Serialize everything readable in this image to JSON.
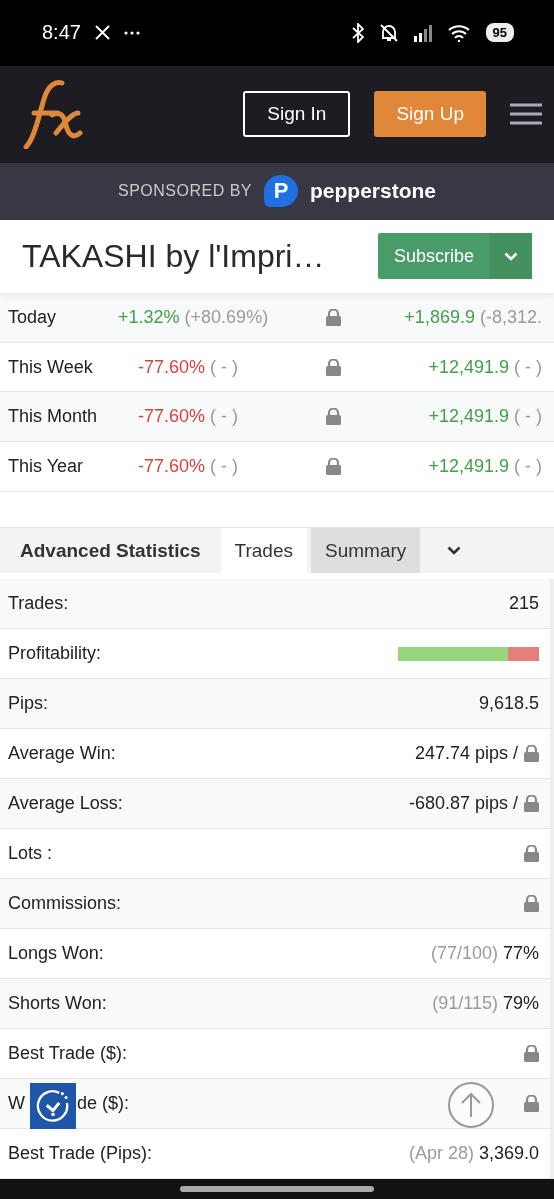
{
  "status_bar": {
    "time": "8:47",
    "battery": "95"
  },
  "header": {
    "buttons": [
      {
        "label": "Sign In",
        "kind": "outline"
      },
      {
        "label": "Sign Up",
        "kind": "filled"
      }
    ]
  },
  "sponsor": {
    "label": "SPONSORED BY",
    "brand": "pepperstone",
    "brand_mark": "P"
  },
  "title": {
    "text": "TAKASHI by l'Impri…",
    "button": "Subscribe"
  },
  "periods": [
    {
      "label": "Today",
      "gain": "+1.32%",
      "gain_positive": true,
      "gain_extra": "(+80.69%)",
      "pips": "+1,869.9",
      "pips_extra": "(-8,312."
    },
    {
      "label": "This Week",
      "gain": "-77.60%",
      "gain_positive": false,
      "gain_extra": "( - )",
      "pips": "+12,491.9",
      "pips_extra": "( - )"
    },
    {
      "label": "This Month",
      "gain": "-77.60%",
      "gain_positive": false,
      "gain_extra": "( - )",
      "pips": "+12,491.9",
      "pips_extra": "( - )"
    },
    {
      "label": "This Year",
      "gain": "-77.60%",
      "gain_positive": false,
      "gain_extra": "( - )",
      "pips": "+12,491.9",
      "pips_extra": "( - )"
    }
  ],
  "tabs": [
    {
      "label": "Advanced Statistics",
      "kind": "heading"
    },
    {
      "label": "Trades",
      "kind": "tab",
      "selected": true
    },
    {
      "label": "Summary",
      "kind": "tab",
      "selected": false
    }
  ],
  "stats": [
    {
      "label": "Trades:",
      "kind": "text",
      "value": "215"
    },
    {
      "label": "Profitability:",
      "kind": "bar",
      "level": 0.78
    },
    {
      "label": "Pips:",
      "kind": "text",
      "value": "9,618.5"
    },
    {
      "label": "Average Win:",
      "kind": "text_lock",
      "value": "247.74 pips /"
    },
    {
      "label": "Average Loss:",
      "kind": "text_lock",
      "value": "-680.87 pips /"
    },
    {
      "label": "Lots :",
      "kind": "lock"
    },
    {
      "label": "Commissions:",
      "kind": "lock"
    },
    {
      "label": "Longs Won:",
      "kind": "text",
      "note": "(77/100)",
      "value": "77%"
    },
    {
      "label": "Shorts Won:",
      "kind": "text",
      "note": "(91/115)",
      "value": "79%"
    },
    {
      "label": "Best Trade ($):",
      "kind": "lock"
    },
    {
      "label_parts": [
        "W",
        "de ($):"
      ],
      "kind": "lock"
    },
    {
      "label": "Best Trade (Pips):",
      "kind": "text",
      "note": "(Apr 28)",
      "value": "3,369.0"
    }
  ]
}
